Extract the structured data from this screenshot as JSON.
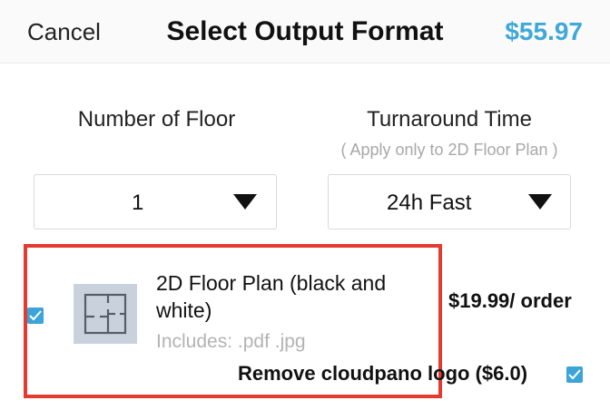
{
  "header": {
    "cancel_label": "Cancel",
    "title": "Select Output Format",
    "total_price": "$55.97"
  },
  "floors": {
    "label": "Number of Floor",
    "selected": "1"
  },
  "turnaround": {
    "label": "Turnaround Time",
    "note": "( Apply only to 2D Floor Plan )",
    "selected": "24h Fast"
  },
  "option": {
    "title": "2D Floor Plan (black and white)",
    "includes": "Includes: .pdf  .jpg",
    "price": "$19.99/ order",
    "checked": true,
    "thumbnail_icon": "floor-plan-icon",
    "remove_logo_label": "Remove cloudpano logo ($6.0)",
    "remove_logo_checked": true
  },
  "colors": {
    "accent": "#3fa8d8",
    "checkbox": "#3ba4d8",
    "highlight_border": "#e53a2f",
    "muted_text": "#b3b3b3"
  }
}
